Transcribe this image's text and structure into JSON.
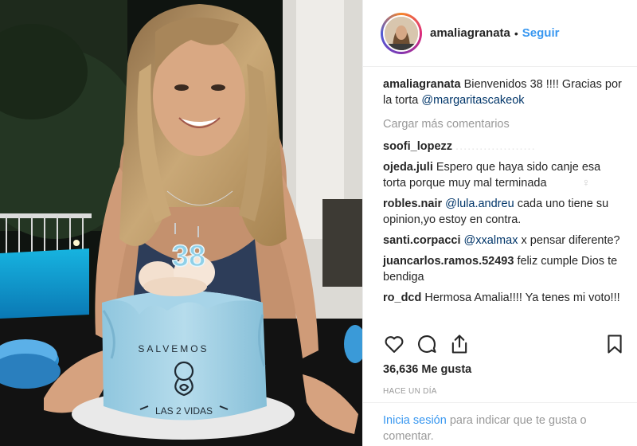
{
  "post": {
    "username": "amaliagranata",
    "follow_label": "Seguir",
    "separator": "•",
    "caption": {
      "user": "amaliagranata",
      "text": "Bienvenidos 38 !!!! Gracias por la torta",
      "mention": "@margaritascakeok"
    },
    "load_more_label": "Cargar más comentarios",
    "comments": [
      {
        "user": "soofi_lopezz",
        "text": "",
        "faded": "...................."
      },
      {
        "user": "ojeda.juli",
        "text": "Espero que haya sido canje esa torta porque muy mal terminada",
        "faded": "♀"
      },
      {
        "user": "robles.nair",
        "mention": "@lula.andreu",
        "text": "cada uno tiene su opinion,yo estoy en contra."
      },
      {
        "user": "santi.corpacci",
        "mention": "@xxalmax",
        "text": "x pensar diferente?"
      },
      {
        "user": "juancarlos.ramos.52493",
        "text": "feliz cumple Dios te bendiga"
      },
      {
        "user": "ro_dcd",
        "text": "Hermosa Amalia!!!! Ya tenes mi voto!!!"
      }
    ],
    "likes_label": "36,636 Me gusta",
    "time_ago": "HACE UN DÍA",
    "login_link": "Inicia sesión",
    "login_text": "para indicar que te gusta o comentar."
  },
  "photo": {
    "candle_text": "38",
    "cake_text_top": "SALVEMOS",
    "cake_text_bottom": "LAS 2 VIDAS"
  },
  "icons": [
    "heart-icon",
    "comment-icon",
    "share-icon",
    "bookmark-icon"
  ],
  "colors": {
    "link": "#3897f0",
    "mention": "#003569",
    "muted": "#999999"
  }
}
